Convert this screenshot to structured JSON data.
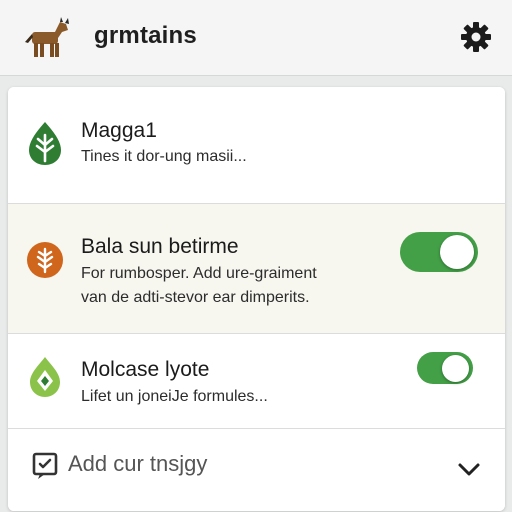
{
  "header": {
    "title": "grmtains",
    "logo_icon": "horse-icon",
    "settings_icon": "gear-icon"
  },
  "items": [
    {
      "title": "Magga1",
      "description": "Tines it dor-ung masii...",
      "icon": "green-leaf-icon",
      "icon_color": "#2e7d32"
    },
    {
      "title": "Bala sun betirme",
      "description_line1": "For rumbosper. Add ure-graiment",
      "description_line2": "van de adti-stevor ear dimperits.",
      "icon": "orange-leaf-icon",
      "icon_color": "#d0651c",
      "toggle_on": true,
      "toggle_color": "#43a047"
    },
    {
      "title": "Molcase lyote",
      "description": "Lifet un joneiJe formules...",
      "icon": "lime-drop-icon",
      "icon_color": "#8bc34a",
      "toggle_on": true,
      "toggle_color": "#43a047"
    }
  ],
  "add_row": {
    "label": "Add cur tnsjgy",
    "icon": "add-note-icon",
    "expand_icon": "chevron-down-icon"
  }
}
